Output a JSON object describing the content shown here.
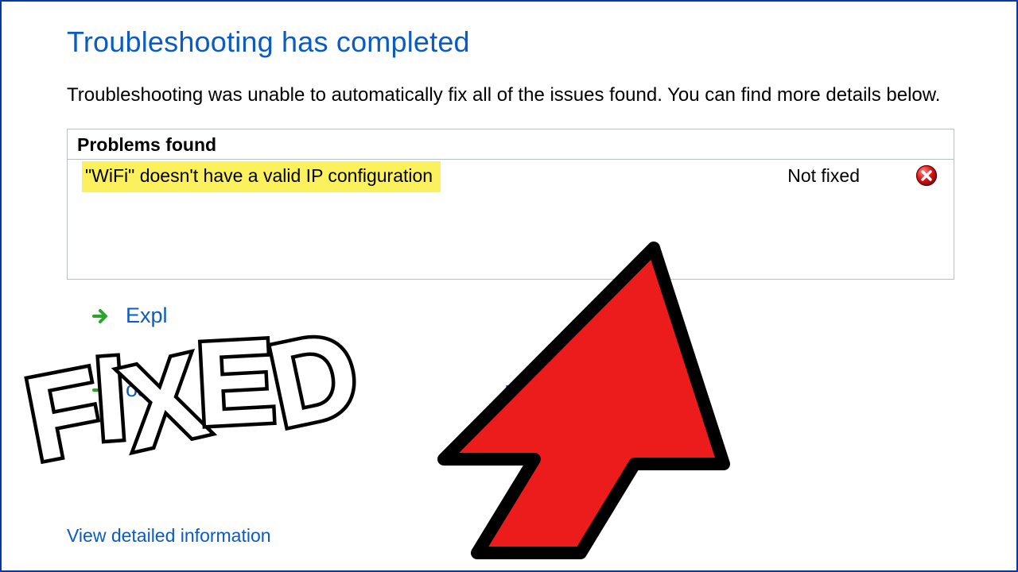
{
  "title": "Troubleshooting has completed",
  "subtext": "Troubleshooting was unable to automatically fix all of the issues found. You can find more details below.",
  "problems": {
    "header": "Problems found",
    "row": {
      "text": "\"WiFi\" doesn't have a valid IP configuration",
      "status": "Not fixed"
    }
  },
  "options": {
    "first_partial": "Expl",
    "second_partial_left": "os",
    "second_partial_right": "r"
  },
  "detail_link": "View detailed information",
  "overlay_text": "FIXED"
}
